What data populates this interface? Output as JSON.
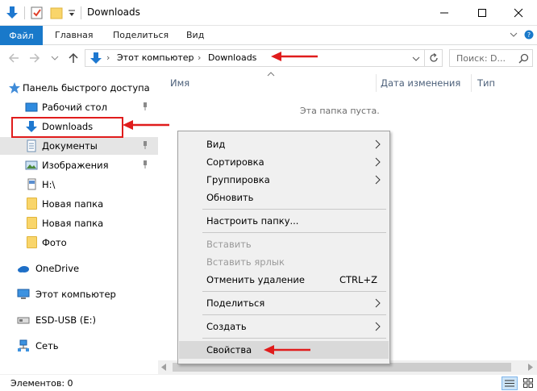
{
  "window": {
    "title": "Downloads",
    "controls": {
      "minimize": "─",
      "maximize": "☐",
      "close": "✕"
    }
  },
  "ribbon": {
    "file_tab": "Файл",
    "tabs": [
      "Главная",
      "Поделиться",
      "Вид"
    ],
    "expand": "˅"
  },
  "address": {
    "path": [
      "Этот компьютер",
      "Downloads"
    ],
    "separator": "›",
    "search_placeholder": "Поиск: D..."
  },
  "nav": {
    "quick_access": "Панель быстрого доступа",
    "items": [
      {
        "label": "Рабочий стол",
        "icon": "desktop-icon",
        "pinned": true
      },
      {
        "label": "Downloads",
        "icon": "download-icon",
        "pinned": false
      },
      {
        "label": "Документы",
        "icon": "documents-icon",
        "pinned": true
      },
      {
        "label": "Изображения",
        "icon": "pictures-icon",
        "pinned": true
      },
      {
        "label": "H:\\",
        "icon": "drive-icon",
        "pinned": false
      },
      {
        "label": "Новая папка",
        "icon": "folder-icon",
        "pinned": false
      },
      {
        "label": "Новая папка",
        "icon": "folder-icon",
        "pinned": false
      },
      {
        "label": "Фото",
        "icon": "folder-icon",
        "pinned": false
      }
    ],
    "onedrive": "OneDrive",
    "this_pc": "Этот компьютер",
    "usb": "ESD-USB (E:)",
    "network": "Сеть"
  },
  "content": {
    "columns": [
      "Имя",
      "Дата изменения",
      "Тип"
    ],
    "empty_text": "Эта папка пуста."
  },
  "context_menu": {
    "items": [
      {
        "label": "Вид",
        "submenu": true
      },
      {
        "label": "Сортировка",
        "submenu": true
      },
      {
        "label": "Группировка",
        "submenu": true
      },
      {
        "label": "Обновить"
      },
      {
        "label": "Настроить папку..."
      },
      {
        "label": "Вставить",
        "disabled": true
      },
      {
        "label": "Вставить ярлык",
        "disabled": true
      },
      {
        "label": "Отменить удаление",
        "shortcut": "CTRL+Z"
      },
      {
        "label": "Поделиться",
        "submenu": true
      },
      {
        "label": "Создать",
        "submenu": true
      },
      {
        "label": "Свойства",
        "highlighted": true
      }
    ]
  },
  "status": {
    "items_text": "Элементов: 0"
  },
  "colors": {
    "accent": "#1979ca",
    "highlight_red": "#e01c1c",
    "menu_bg": "#f0f0f0",
    "selected_bg": "#e5e5e5"
  }
}
